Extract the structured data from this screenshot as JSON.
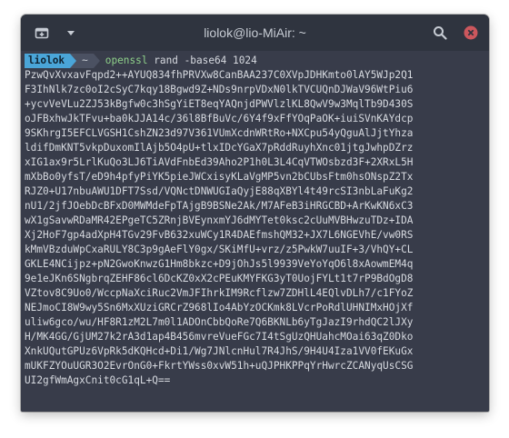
{
  "window": {
    "title": "liolok@lio-MiAir: ~"
  },
  "titlebar": {
    "new_tab_icon": "new-tab-icon",
    "menu_icon": "chevron-down-icon",
    "search_icon": "search-icon",
    "close_icon": "close-icon",
    "close_color": "#cc575d"
  },
  "prompt": {
    "user": "liolok",
    "dir": "~",
    "command": "openssl",
    "args": " rand -base64 1024"
  },
  "output": [
    "PzwQvXvxavFqpd2++AYUQ834fhPRVXw8CanBAA237C0XVpJDHKmto0lAY5WJp2Q1",
    "F3IhNlk7zc0oI2cSyC7kqy18Bgwd9Z+NDs9nrpVDxN0lkTVCUQnDJWaV96WtPiu6",
    "+ycvVeVLu2ZJ53kBgfw0c3hSgYiET8eqYAQnjdPWVlzlKL8QwV9w3MqlTb9D430S",
    "oJFBxhwJkTFvu+ba0kJJA14c/36l8BfBuVc/6Y4f9xFfYOqPaOK+iuiSVnKAYdcp",
    "9SKhrgI5EFCLVGSH1CshZN23d97V361VUmXcdnWRtRo+NXCpu54yQguAlJjtYhza",
    "ldifDmKNT5vkpDuxomIlAjb5O4pU+tlxIDcYGaX7pRddRuyhXnc01jtgJwhpDZrz",
    "xIG1ax9r5LrlKuQo3LJ6TiAVdFnbEd39Aho2P1h0L3L4CqVTWOsbzd3F+2XRxL5H",
    "mXbBo0yfsT/eD9h4pfyPiYK5pieJWCxisyKLaVgMP5vn2bCUbsFtm0hsONspZ2Tx",
    "RJZ0+U17nbuAWU1DFT7Ssd/VQNctDNWUGIaQyjE88qXBYl4t49rcSI3nbLaFuKg2",
    "nU1/2jfJOebDcBFxD0MWMdeFpTAjgB9BSNe2Ak/M7AFeB3iHRGCBD+ArKwKN6xC3",
    "wX1gSavwRDaMR42EPgeTC5ZRnjBVEynxmYJ6dMYTet0ksc2cUuMVBHwzuTDz+IDA",
    "Xj2HoF7gp4adXpH4TGv29FvB632xuWCy1R4DAEfmshQM32+JX7L6NGEVhE/vw0RS",
    "kMmVBzduWpCxaRULY8C3p9gAeFlY0gx/SKiMfU+vrz/z5PwkW7uuIF+3/VhQY+CL",
    "GKLE4NCijpz+pN2GwoKnwzG1Hm8bkzc+D9jOhJs5l9939VeYoYqO6l8xAowmEM4q",
    "9e1eJKn6SNgbrqZEHF86cl6DcKZ0xX2cPEuKMYFKG3yT0UojFYLt1t7rP9BdOgD8",
    "VZtov8C9Uo0/WccpNaXciRuc2VmJFIhrkIM9Rcflzw7ZDHlL4EQlvDLh7/c1FYoZ",
    "NEJmoCI8W9wy5Sn6MxXUziGRCrZ968lIo4AbYzOCKmk8LVcrPoRdlUHNIMxHOjXf",
    "uliw6gco/wu/HF8R1zM2L7m0l1ADOnCbbQoRe7Q6BKNLb6yTgJazI9rhdQC2lJXy",
    "H/MK4GG/GjUM27k2rA3d1ap4B456mvreVueFGc7I4tSgUzQHUahcMOai63qZ0Dko",
    "XnkUQutGPUz6VpRk5dKQHcd+Di1/Wg7JNlcnHul7R4JhS/9H4U4Iza1VV0fEKuGx",
    "mUKFZYOuUGR3O2EvrOnG0+FkrtYWss0xvW51h+uQJPHKPPqYrHwrcZCANyqUsCSG",
    "UI2gfWmAgxCnit0cG1qL+Q=="
  ]
}
